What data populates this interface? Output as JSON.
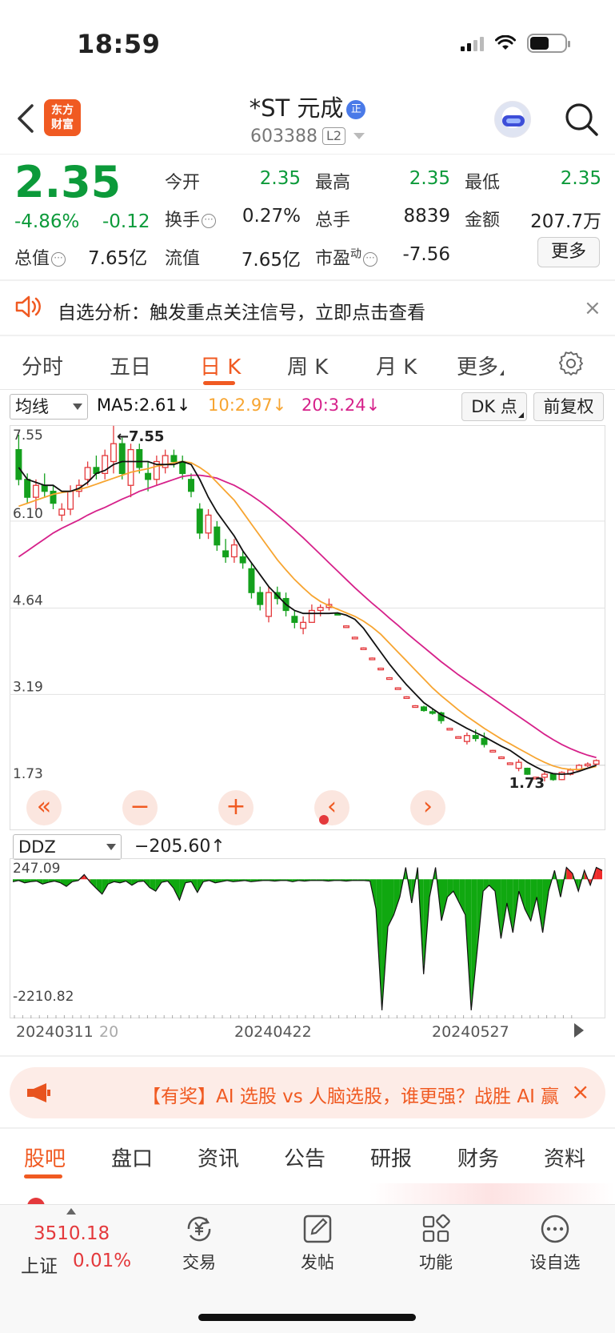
{
  "status_bar": {
    "time": "18:59"
  },
  "header": {
    "logo_text_1": "东方",
    "logo_text_2": "财富",
    "title": "*ST 元成",
    "title_badge": "正",
    "code": "603388",
    "code_badge": "L2"
  },
  "quote": {
    "price": "2.35",
    "change_pct": "-4.86%",
    "change_amt": "-0.12",
    "total_cap_label": "总值",
    "total_cap": "7.65亿",
    "rows": [
      [
        {
          "label": "今开",
          "value": "2.35",
          "color": "green"
        },
        {
          "label": "最高",
          "value": "2.35",
          "color": "green"
        },
        {
          "label": "最低",
          "value": "2.35",
          "color": "green"
        }
      ],
      [
        {
          "label": "换手",
          "value": "0.27%",
          "color": "black",
          "info": true
        },
        {
          "label": "总手",
          "value": "8839",
          "color": "black"
        },
        {
          "label": "金额",
          "value": "207.7万",
          "color": "black"
        }
      ],
      [
        {
          "label": "流值",
          "value": "7.65亿",
          "color": "black"
        },
        {
          "label": "市盈",
          "value": "-7.56",
          "color": "black",
          "sup": "动",
          "info": true
        }
      ]
    ],
    "more_button": "更多"
  },
  "banner": {
    "text": "自选分析：触发重点关注信号，立即点击查看",
    "close": "×"
  },
  "tabs": [
    "分时",
    "五日",
    "日 K",
    "周 K",
    "月 K",
    "更多"
  ],
  "active_tab": 2,
  "chart_toolbar": {
    "indicator_select": "均线",
    "ma5": "MA5:2.61",
    "ma10": "10:2.97",
    "ma20": "20:3.24",
    "dk_button": "DK 点",
    "fq_button": "前复权",
    "ma5_color": "#111111",
    "ma10_color": "#f7a531",
    "ma20_color": "#d6218a"
  },
  "chart_controls": [
    "«",
    "−",
    "+",
    "‹",
    "›"
  ],
  "sub_toolbar": {
    "indicator_select": "DDZ",
    "value": "−205.60"
  },
  "dates": [
    "20240311",
    "20",
    "20240422",
    "20240527"
  ],
  "promo": {
    "text": "【有奖】AI 选股 vs 人脑选股，谁更强？战胜 AI 赢",
    "close": "×"
  },
  "bottom_tabs": [
    "股吧",
    "盘口",
    "资讯",
    "公告",
    "研报",
    "财务",
    "资料"
  ],
  "bottom_nav": {
    "index_value": "3510.18",
    "index_name": "上证",
    "index_change": "0.01%",
    "items": [
      "交易",
      "发帖",
      "功能",
      "设自选"
    ]
  },
  "chart_data": [
    {
      "type": "candlestick",
      "title": "",
      "y_ticks": [
        "7.55",
        "6.10",
        "4.64",
        "3.19",
        "1.73"
      ],
      "ylim": [
        1.73,
        7.55
      ],
      "annotations": [
        "←7.55",
        "1.73"
      ],
      "x_labels": [
        "20240311",
        "20240422",
        "20240527"
      ],
      "candles": [
        [
          7.3,
          7.55,
          6.7,
          6.8
        ],
        [
          6.8,
          6.9,
          6.4,
          6.5
        ],
        [
          6.5,
          6.8,
          6.3,
          6.7
        ],
        [
          6.7,
          6.9,
          6.5,
          6.6
        ],
        [
          6.6,
          6.7,
          6.3,
          6.4
        ],
        [
          6.2,
          6.4,
          6.1,
          6.3
        ],
        [
          6.3,
          6.7,
          6.2,
          6.6
        ],
        [
          6.6,
          6.8,
          6.5,
          6.7
        ],
        [
          6.8,
          7.1,
          6.7,
          7.0
        ],
        [
          7.0,
          7.2,
          6.8,
          6.9
        ],
        [
          6.9,
          7.3,
          6.8,
          7.2
        ],
        [
          7.1,
          7.7,
          6.9,
          7.4
        ],
        [
          7.4,
          7.5,
          6.8,
          6.9
        ],
        [
          6.7,
          7.4,
          6.5,
          7.3
        ],
        [
          7.3,
          7.4,
          6.9,
          7.0
        ],
        [
          6.9,
          7.1,
          6.6,
          6.8
        ],
        [
          6.8,
          7.2,
          6.7,
          7.1
        ],
        [
          7.0,
          7.3,
          6.9,
          7.2
        ],
        [
          7.2,
          7.3,
          7.0,
          7.1
        ],
        [
          7.1,
          7.2,
          6.8,
          6.9
        ],
        [
          6.8,
          6.9,
          6.5,
          6.6
        ],
        [
          6.3,
          6.4,
          5.8,
          5.9
        ],
        [
          5.9,
          6.3,
          5.8,
          6.2
        ],
        [
          6.0,
          6.1,
          5.6,
          5.7
        ],
        [
          5.6,
          5.8,
          5.4,
          5.5
        ],
        [
          5.5,
          5.8,
          5.4,
          5.7
        ],
        [
          5.5,
          5.6,
          5.3,
          5.4
        ],
        [
          5.3,
          5.4,
          4.8,
          4.9
        ],
        [
          4.9,
          5.0,
          4.6,
          4.7
        ],
        [
          4.5,
          5.0,
          4.4,
          4.9
        ],
        [
          4.9,
          5.0,
          4.7,
          4.8
        ],
        [
          4.8,
          4.9,
          4.5,
          4.6
        ],
        [
          4.5,
          4.6,
          4.3,
          4.4
        ],
        [
          4.3,
          4.5,
          4.2,
          4.4
        ],
        [
          4.4,
          4.7,
          4.4,
          4.6
        ],
        [
          4.6,
          4.7,
          4.5,
          4.65
        ],
        [
          4.65,
          4.8,
          4.6,
          4.7
        ],
        [
          4.55,
          4.56,
          4.53,
          4.54
        ],
        [
          4.34,
          4.35,
          4.33,
          4.34
        ],
        [
          4.15,
          4.16,
          4.14,
          4.15
        ],
        [
          3.97,
          3.98,
          3.96,
          3.97
        ],
        [
          3.8,
          3.81,
          3.79,
          3.8
        ],
        [
          3.63,
          3.64,
          3.62,
          3.63
        ],
        [
          3.47,
          3.48,
          3.46,
          3.47
        ],
        [
          3.3,
          3.31,
          3.29,
          3.3
        ],
        [
          3.15,
          3.16,
          3.14,
          3.15
        ],
        [
          3.0,
          3.01,
          2.99,
          3.0
        ],
        [
          2.98,
          3.0,
          2.9,
          2.92
        ],
        [
          2.9,
          2.95,
          2.85,
          2.88
        ],
        [
          2.88,
          2.9,
          2.7,
          2.75
        ],
        [
          2.62,
          2.63,
          2.61,
          2.62
        ],
        [
          2.48,
          2.49,
          2.47,
          2.48
        ],
        [
          2.4,
          2.55,
          2.35,
          2.5
        ],
        [
          2.5,
          2.6,
          2.4,
          2.45
        ],
        [
          2.45,
          2.55,
          2.3,
          2.35
        ],
        [
          2.25,
          2.26,
          2.24,
          2.25
        ],
        [
          2.14,
          2.15,
          2.13,
          2.14
        ],
        [
          2.04,
          2.05,
          2.03,
          2.04
        ],
        [
          1.95,
          2.1,
          1.9,
          2.05
        ],
        [
          1.95,
          1.96,
          1.84,
          1.85
        ],
        [
          1.8,
          1.81,
          1.79,
          1.8
        ],
        [
          1.8,
          1.9,
          1.73,
          1.85
        ],
        [
          1.85,
          1.86,
          1.74,
          1.76
        ],
        [
          1.76,
          1.9,
          1.75,
          1.88
        ],
        [
          1.85,
          1.95,
          1.83,
          1.92
        ],
        [
          1.92,
          2.02,
          1.9,
          2.0
        ],
        [
          2.0,
          2.05,
          1.97,
          2.02
        ],
        [
          2.02,
          2.1,
          2.0,
          2.08
        ]
      ],
      "ma5": [
        7.0,
        6.8,
        6.75,
        6.7,
        6.7,
        6.6,
        6.6,
        6.65,
        6.75,
        6.9,
        6.95,
        7.05,
        7.1,
        7.1,
        7.1,
        7.1,
        7.05,
        7.05,
        7.05,
        7.1,
        7.05,
        6.8,
        6.5,
        6.25,
        6.05,
        5.85,
        5.6,
        5.4,
        5.2,
        5.0,
        4.85,
        4.7,
        4.6,
        4.55,
        4.55,
        4.55,
        4.55,
        4.56,
        4.52,
        4.45,
        4.3,
        4.1,
        3.9,
        3.7,
        3.52,
        3.35,
        3.2,
        3.05,
        2.95,
        2.85,
        2.78,
        2.7,
        2.62,
        2.55,
        2.48,
        2.4,
        2.32,
        2.25,
        2.15,
        2.05,
        1.97,
        1.9,
        1.86,
        1.85,
        1.86,
        1.9,
        1.95,
        2.0
      ],
      "ma10": [
        6.35,
        6.4,
        6.45,
        6.5,
        6.55,
        6.58,
        6.6,
        6.63,
        6.67,
        6.72,
        6.77,
        6.82,
        6.87,
        6.92,
        6.95,
        6.98,
        7.02,
        7.05,
        7.08,
        7.1,
        7.08,
        7.0,
        6.9,
        6.75,
        6.6,
        6.45,
        6.25,
        6.05,
        5.85,
        5.65,
        5.45,
        5.28,
        5.12,
        4.98,
        4.85,
        4.75,
        4.68,
        4.62,
        4.56,
        4.5,
        4.42,
        4.32,
        4.2,
        4.05,
        3.9,
        3.75,
        3.6,
        3.45,
        3.3,
        3.17,
        3.05,
        2.93,
        2.82,
        2.72,
        2.62,
        2.53,
        2.44,
        2.36,
        2.28,
        2.2,
        2.12,
        2.05,
        1.99,
        1.95,
        1.93,
        1.93,
        1.95,
        1.98
      ],
      "ma20": [
        5.5,
        5.6,
        5.7,
        5.8,
        5.9,
        5.98,
        6.05,
        6.12,
        6.2,
        6.27,
        6.33,
        6.4,
        6.47,
        6.53,
        6.6,
        6.65,
        6.7,
        6.75,
        6.8,
        6.85,
        6.87,
        6.87,
        6.85,
        6.82,
        6.76,
        6.7,
        6.62,
        6.53,
        6.43,
        6.32,
        6.2,
        6.08,
        5.95,
        5.82,
        5.68,
        5.54,
        5.4,
        5.26,
        5.12,
        4.98,
        4.85,
        4.72,
        4.6,
        4.47,
        4.35,
        4.22,
        4.1,
        3.98,
        3.86,
        3.74,
        3.63,
        3.52,
        3.42,
        3.32,
        3.22,
        3.12,
        3.02,
        2.92,
        2.82,
        2.72,
        2.62,
        2.52,
        2.43,
        2.35,
        2.28,
        2.22,
        2.17,
        2.13
      ]
    },
    {
      "type": "area",
      "title": "DDZ",
      "y_ticks": [
        "247.09",
        "-2210.82"
      ],
      "ylim": [
        -2210.82,
        247.09
      ],
      "values": [
        -40,
        -20,
        -60,
        -40,
        -30,
        -80,
        -50,
        -30,
        -60,
        -120,
        -40,
        -20,
        80,
        -50,
        -150,
        -250,
        -80,
        -40,
        -60,
        -30,
        -100,
        -40,
        -30,
        -140,
        -200,
        -50,
        -30,
        -150,
        -350,
        -60,
        -40,
        -220,
        -40,
        -20,
        -60,
        -40,
        -20,
        -40,
        -30,
        -20,
        -40,
        -30,
        -20,
        -20,
        -30,
        -20,
        -20,
        -40,
        -20,
        -30,
        -20,
        -20,
        -20,
        -30,
        -20,
        -20,
        -30,
        -20,
        -20,
        -20,
        -30,
        -500,
        -2210,
        -800,
        -600,
        -300,
        200,
        -400,
        200,
        -1600,
        -300,
        200,
        -700,
        -300,
        -200,
        -400,
        -600,
        -2210,
        -1200,
        -200,
        -100,
        -200,
        -1000,
        -400,
        -900,
        -200,
        -500,
        -700,
        -300,
        -900,
        -200,
        150,
        -300,
        200,
        100,
        -200,
        150,
        -100,
        200,
        150
      ]
    }
  ]
}
